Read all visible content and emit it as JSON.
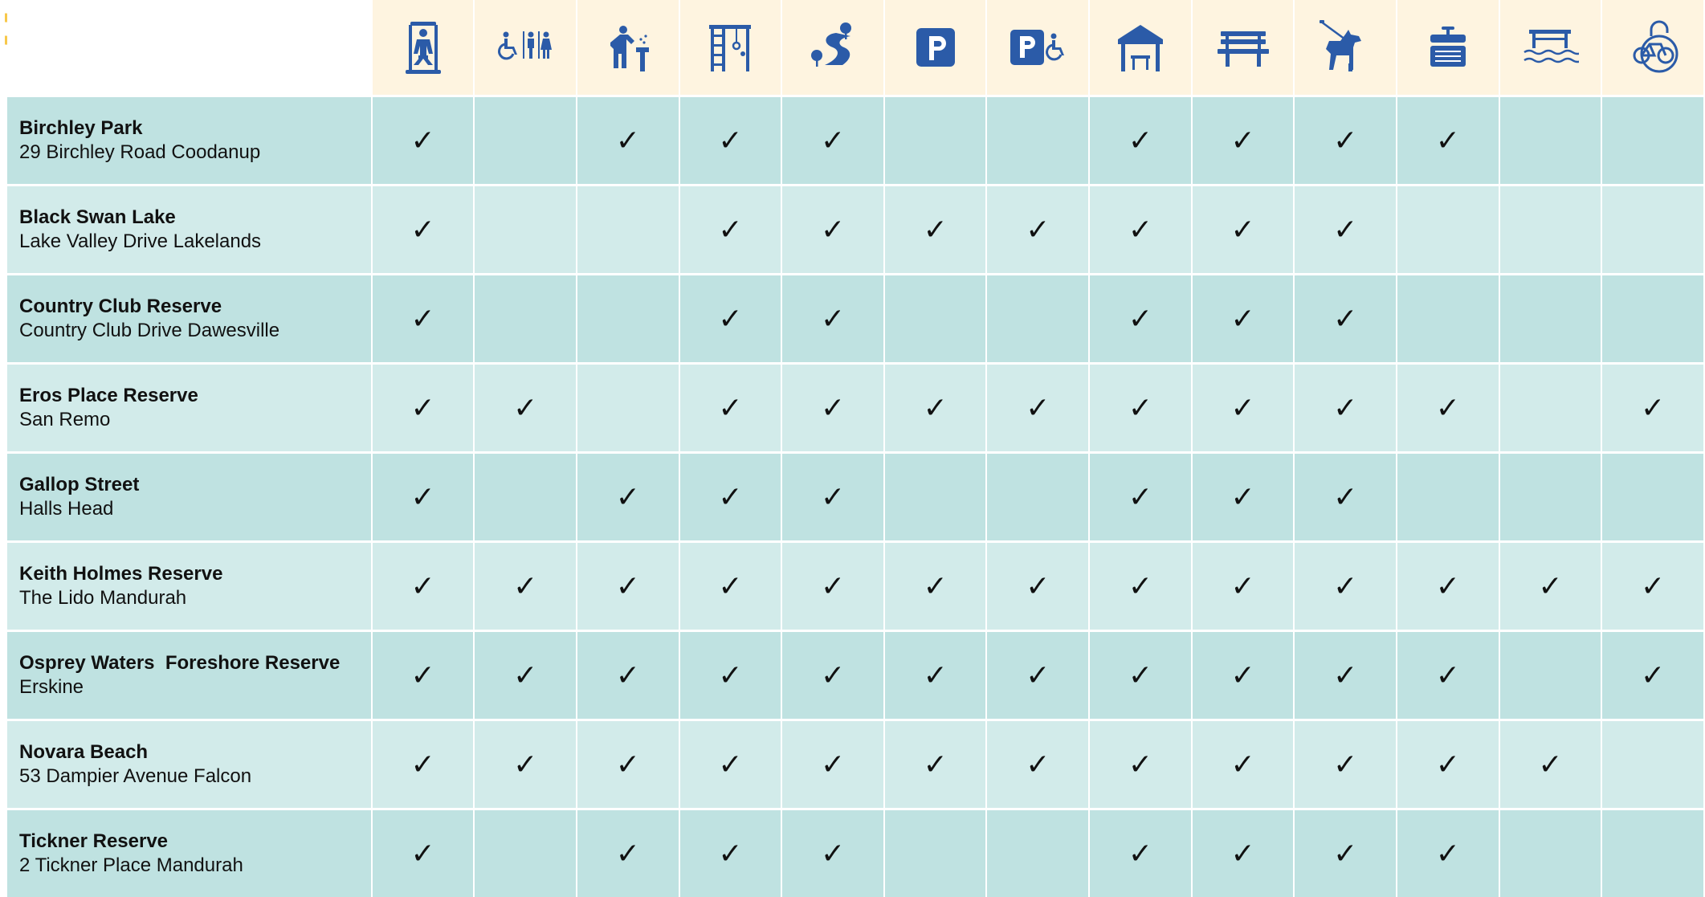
{
  "icons": [
    {
      "name": "fitness-equipment-icon"
    },
    {
      "name": "accessible-toilets-icon"
    },
    {
      "name": "drinking-fountain-icon"
    },
    {
      "name": "playground-icon"
    },
    {
      "name": "walking-path-icon"
    },
    {
      "name": "parking-icon"
    },
    {
      "name": "accessible-parking-icon"
    },
    {
      "name": "shelter-icon"
    },
    {
      "name": "bench-seating-icon"
    },
    {
      "name": "dog-on-leash-icon"
    },
    {
      "name": "bbq-icon"
    },
    {
      "name": "jetty-water-access-icon"
    },
    {
      "name": "bike-repair-station-icon"
    }
  ],
  "colors": {
    "icon": "#2b5ba8",
    "header_bg": "#fef4e0",
    "row_dark": "#bfe2e1",
    "row_light": "#d2ebea",
    "logo": "#f7c84a"
  },
  "check_symbol": "✓",
  "rows": [
    {
      "name": "Birchley Park",
      "address": "29 Birchley Road Coodanup",
      "checks": [
        1,
        0,
        1,
        1,
        1,
        0,
        0,
        1,
        1,
        1,
        1,
        0,
        0
      ]
    },
    {
      "name": "Black Swan Lake",
      "address": "Lake Valley Drive Lakelands",
      "checks": [
        1,
        0,
        0,
        1,
        1,
        1,
        1,
        1,
        1,
        1,
        0,
        0,
        0
      ]
    },
    {
      "name": "Country Club Reserve",
      "address": "Country Club Drive Dawesville",
      "checks": [
        1,
        0,
        0,
        1,
        1,
        0,
        0,
        1,
        1,
        1,
        0,
        0,
        0
      ]
    },
    {
      "name": "Eros Place Reserve",
      "address": "San Remo",
      "checks": [
        1,
        1,
        0,
        1,
        1,
        1,
        1,
        1,
        1,
        1,
        1,
        0,
        1
      ]
    },
    {
      "name": "Gallop Street",
      "address": "Halls Head",
      "checks": [
        1,
        0,
        1,
        1,
        1,
        0,
        0,
        1,
        1,
        1,
        0,
        0,
        0
      ]
    },
    {
      "name": "Keith Holmes Reserve",
      "address": "The Lido Mandurah",
      "checks": [
        1,
        1,
        1,
        1,
        1,
        1,
        1,
        1,
        1,
        1,
        1,
        1,
        1
      ]
    },
    {
      "name": "Osprey Waters  Foreshore Reserve",
      "address": "Erskine",
      "checks": [
        1,
        1,
        1,
        1,
        1,
        1,
        1,
        1,
        1,
        1,
        1,
        0,
        1
      ]
    },
    {
      "name": "Novara Beach",
      "address": "53 Dampier Avenue Falcon",
      "checks": [
        1,
        1,
        1,
        1,
        1,
        1,
        1,
        1,
        1,
        1,
        1,
        1,
        0
      ]
    },
    {
      "name": "Tickner Reserve",
      "address": "2 Tickner Place Mandurah",
      "checks": [
        1,
        0,
        1,
        1,
        1,
        0,
        0,
        1,
        1,
        1,
        1,
        0,
        0
      ]
    }
  ]
}
